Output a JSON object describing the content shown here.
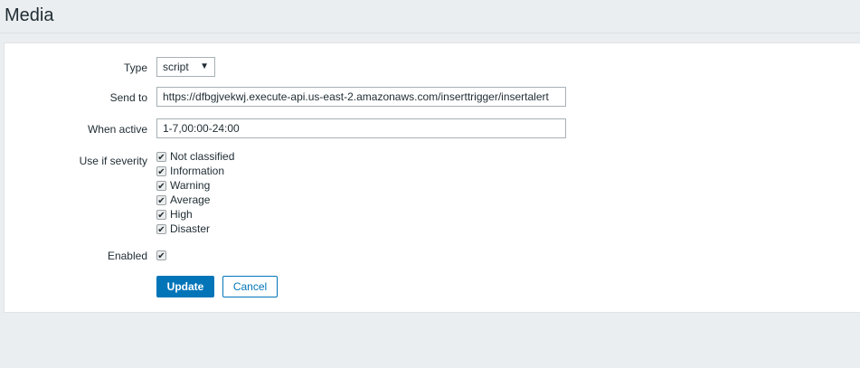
{
  "page": {
    "title": "Media"
  },
  "form": {
    "type_label": "Type",
    "type_value": "script",
    "sendto_label": "Send to",
    "sendto_value": "https://dfbgjvekwj.execute-api.us-east-2.amazonaws.com/inserttrigger/insertalert",
    "active_label": "When active",
    "active_value": "1-7,00:00-24:00",
    "severity_label": "Use if severity",
    "severities": [
      {
        "label": "Not classified",
        "checked": true
      },
      {
        "label": "Information",
        "checked": true
      },
      {
        "label": "Warning",
        "checked": true
      },
      {
        "label": "Average",
        "checked": true
      },
      {
        "label": "High",
        "checked": true
      },
      {
        "label": "Disaster",
        "checked": true
      }
    ],
    "enabled_label": "Enabled",
    "enabled": true,
    "update_label": "Update",
    "cancel_label": "Cancel"
  },
  "colors": {
    "primary": "#0275b8"
  }
}
